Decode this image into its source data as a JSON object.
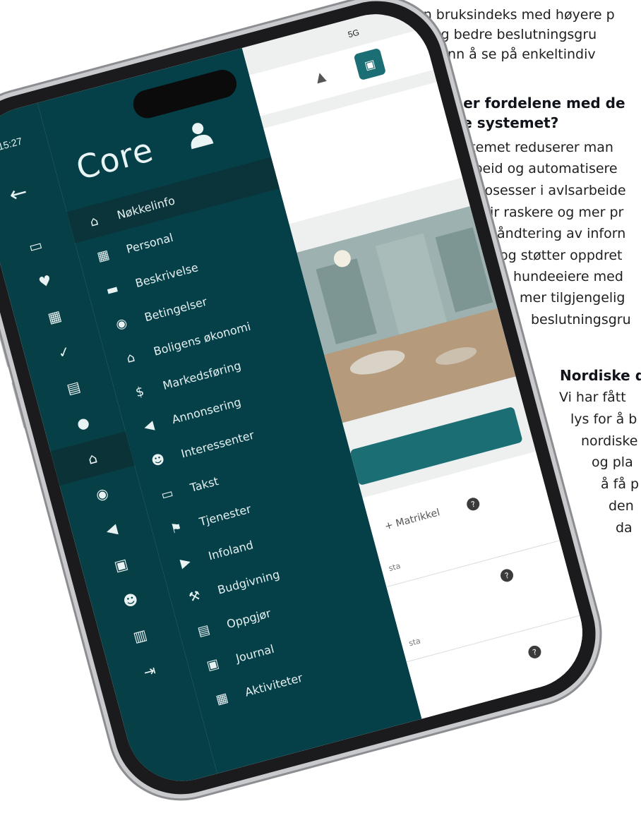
{
  "article": {
    "lines_top": [
      "en bruksindeks med høyere p",
      "sjon og bedre beslutningsgru",
      "for avl enn å se på enkeltindiv"
    ],
    "heading1": [
      "Hva er fordelene med de",
      "nye systemet?"
    ],
    "para1": [
      "Systemet reduserer man",
      "arbeid og automatisere",
      "prosesser i avlsarbeide",
      "gir raskere og mer pr",
      "håndtering av inforn",
      "og støtter oppdret",
      "hundeeiere med",
      "mer tilgjengelig",
      "beslutningsgru"
    ],
    "heading2": "Nordiske d",
    "para2": [
      "Vi har fått",
      "lys for å b",
      "nordiske",
      "og pla",
      "å få p",
      "den",
      "da"
    ]
  },
  "phone": {
    "status_time": "15:27",
    "status_right": "5G",
    "logo": "Core",
    "rail_icons": [
      "laptop-icon",
      "heart-icon",
      "calendar-icon",
      "check-icon",
      "id-card-icon",
      "person-icon",
      "home-icon",
      "money-icon",
      "megaphone-icon",
      "briefcase-icon",
      "user-gear-icon",
      "book-icon",
      "logout-icon"
    ],
    "menu_items": [
      {
        "label": "Nøkkelinfo",
        "icon": "home-icon",
        "glyph": "⌂"
      },
      {
        "label": "Personal",
        "icon": "building-icon",
        "glyph": "▦"
      },
      {
        "label": "Beskrivelse",
        "icon": "note-icon",
        "glyph": "▬"
      },
      {
        "label": "Betingelser",
        "icon": "money-icon",
        "glyph": "◉"
      },
      {
        "label": "Boligens økonomi",
        "icon": "bank-icon",
        "glyph": "⌂"
      },
      {
        "label": "Markedsføring",
        "icon": "dollar-icon",
        "glyph": "$"
      },
      {
        "label": "Annonsering",
        "icon": "megaphone-icon",
        "glyph": "◀"
      },
      {
        "label": "Interessenter",
        "icon": "people-icon",
        "glyph": "☻"
      },
      {
        "label": "Takst",
        "icon": "clipboard-icon",
        "glyph": "▭"
      },
      {
        "label": "Tjenester",
        "icon": "flag-icon",
        "glyph": "⚑"
      },
      {
        "label": "Infoland",
        "icon": "play-icon",
        "glyph": "▶"
      },
      {
        "label": "Budgivning",
        "icon": "gavel-icon",
        "glyph": "⚒"
      },
      {
        "label": "Oppgjør",
        "icon": "card-icon",
        "glyph": "▤"
      },
      {
        "label": "Journal",
        "icon": "book-icon",
        "glyph": "▣"
      },
      {
        "label": "Aktiviteter",
        "icon": "calendar-icon",
        "glyph": "▦"
      }
    ],
    "content": {
      "matrikkel_label": "+ Matrikkel",
      "field_label_1": "sta",
      "field_label_2": "sta",
      "help": "?"
    },
    "colors": {
      "sidebar": "#054049",
      "rail": "#063f46",
      "accent": "#1b6e74"
    }
  }
}
